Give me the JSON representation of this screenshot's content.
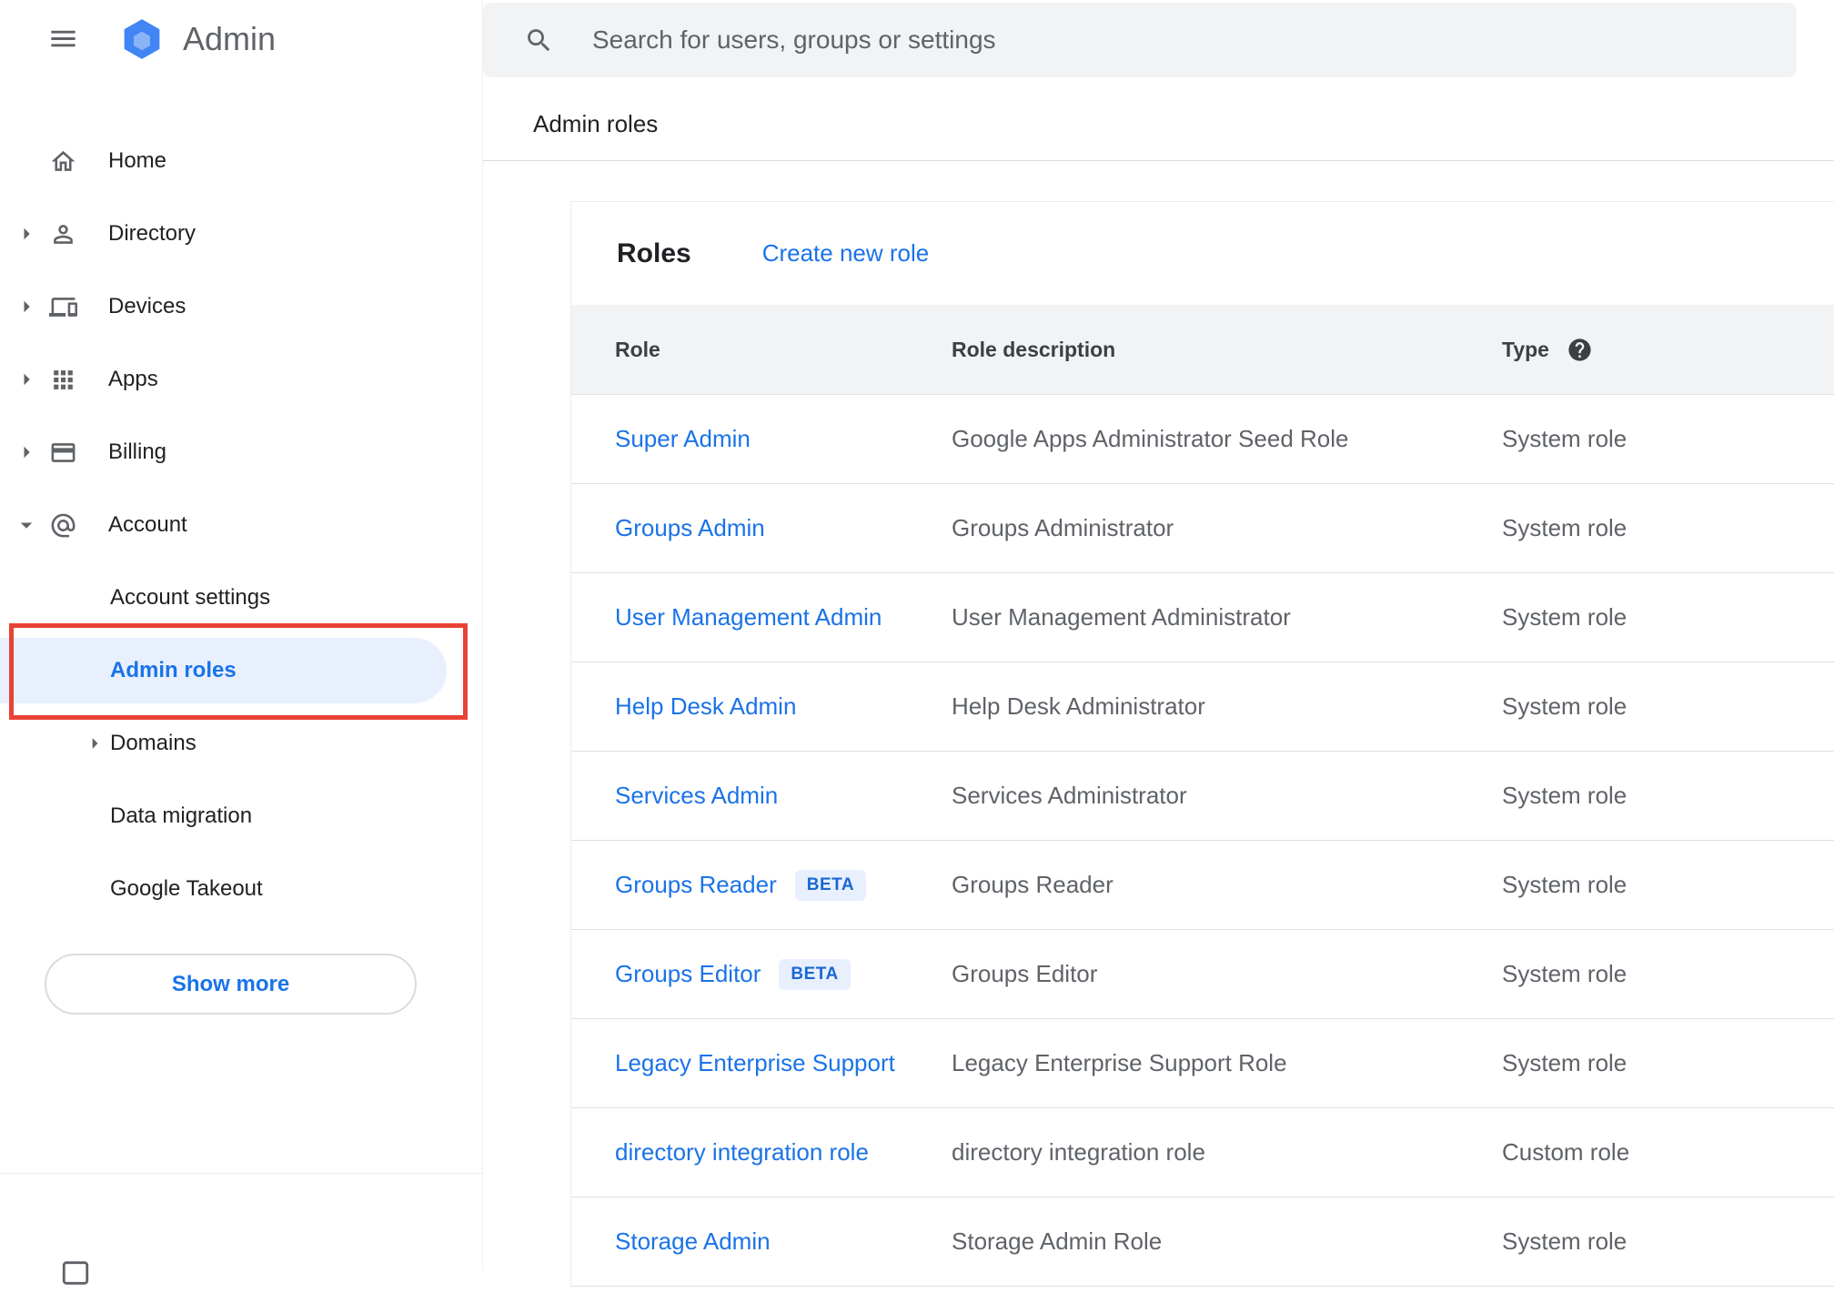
{
  "colors": {
    "accent_blue": "#1a73e8",
    "selected_item_bg": "#e8f0fe",
    "annotation_red": "#e94235",
    "table_header_bg": "#f1f3f4",
    "beta_badge_bg": "#e8f0fe",
    "beta_badge_text": "#1967d2"
  },
  "icons": {
    "menu": "hamburger-icon",
    "logo": "admin-hexagon-icon",
    "search": "search-icon",
    "home": "home-icon",
    "directory": "person-icon",
    "devices": "devices-icon",
    "apps": "apps-grid-icon",
    "billing": "credit-card-icon",
    "account": "at-sign-icon",
    "type_help": "help-icon",
    "collapsed": "chevron-right-icon",
    "expanded": "chevron-down-icon"
  },
  "header": {
    "app_name": "Admin",
    "search_placeholder": "Search for users, groups or settings"
  },
  "breadcrumb": "Admin roles",
  "sidebar": {
    "items": [
      {
        "label": "Home"
      },
      {
        "label": "Directory"
      },
      {
        "label": "Devices"
      },
      {
        "label": "Apps"
      },
      {
        "label": "Billing"
      },
      {
        "label": "Account"
      }
    ],
    "account_children": [
      {
        "label": "Account settings"
      },
      {
        "label": "Admin roles"
      },
      {
        "label": "Domains"
      },
      {
        "label": "Data migration"
      },
      {
        "label": "Google Takeout"
      }
    ],
    "show_more_label": "Show more"
  },
  "main": {
    "title": "Roles",
    "create_new_role_label": "Create new role",
    "table": {
      "columns": [
        "Role",
        "Role description",
        "Type"
      ],
      "rows": [
        {
          "role": "Super Admin",
          "badge": "",
          "description": "Google Apps Administrator Seed Role",
          "type": "System role"
        },
        {
          "role": "Groups Admin",
          "badge": "",
          "description": "Groups Administrator",
          "type": "System role"
        },
        {
          "role": "User Management Admin",
          "badge": "",
          "description": "User Management Administrator",
          "type": "System role"
        },
        {
          "role": "Help Desk Admin",
          "badge": "",
          "description": "Help Desk Administrator",
          "type": "System role"
        },
        {
          "role": "Services Admin",
          "badge": "",
          "description": "Services Administrator",
          "type": "System role"
        },
        {
          "role": "Groups Reader",
          "badge": "BETA",
          "description": "Groups Reader",
          "type": "System role"
        },
        {
          "role": "Groups Editor",
          "badge": "BETA",
          "description": "Groups Editor",
          "type": "System role"
        },
        {
          "role": "Legacy Enterprise Support",
          "badge": "",
          "description": "Legacy Enterprise Support Role",
          "type": "System role"
        },
        {
          "role": "directory integration role",
          "badge": "",
          "description": "directory integration role",
          "type": "Custom role"
        },
        {
          "role": "Storage Admin",
          "badge": "",
          "description": "Storage Admin Role",
          "type": "System role"
        }
      ]
    }
  }
}
